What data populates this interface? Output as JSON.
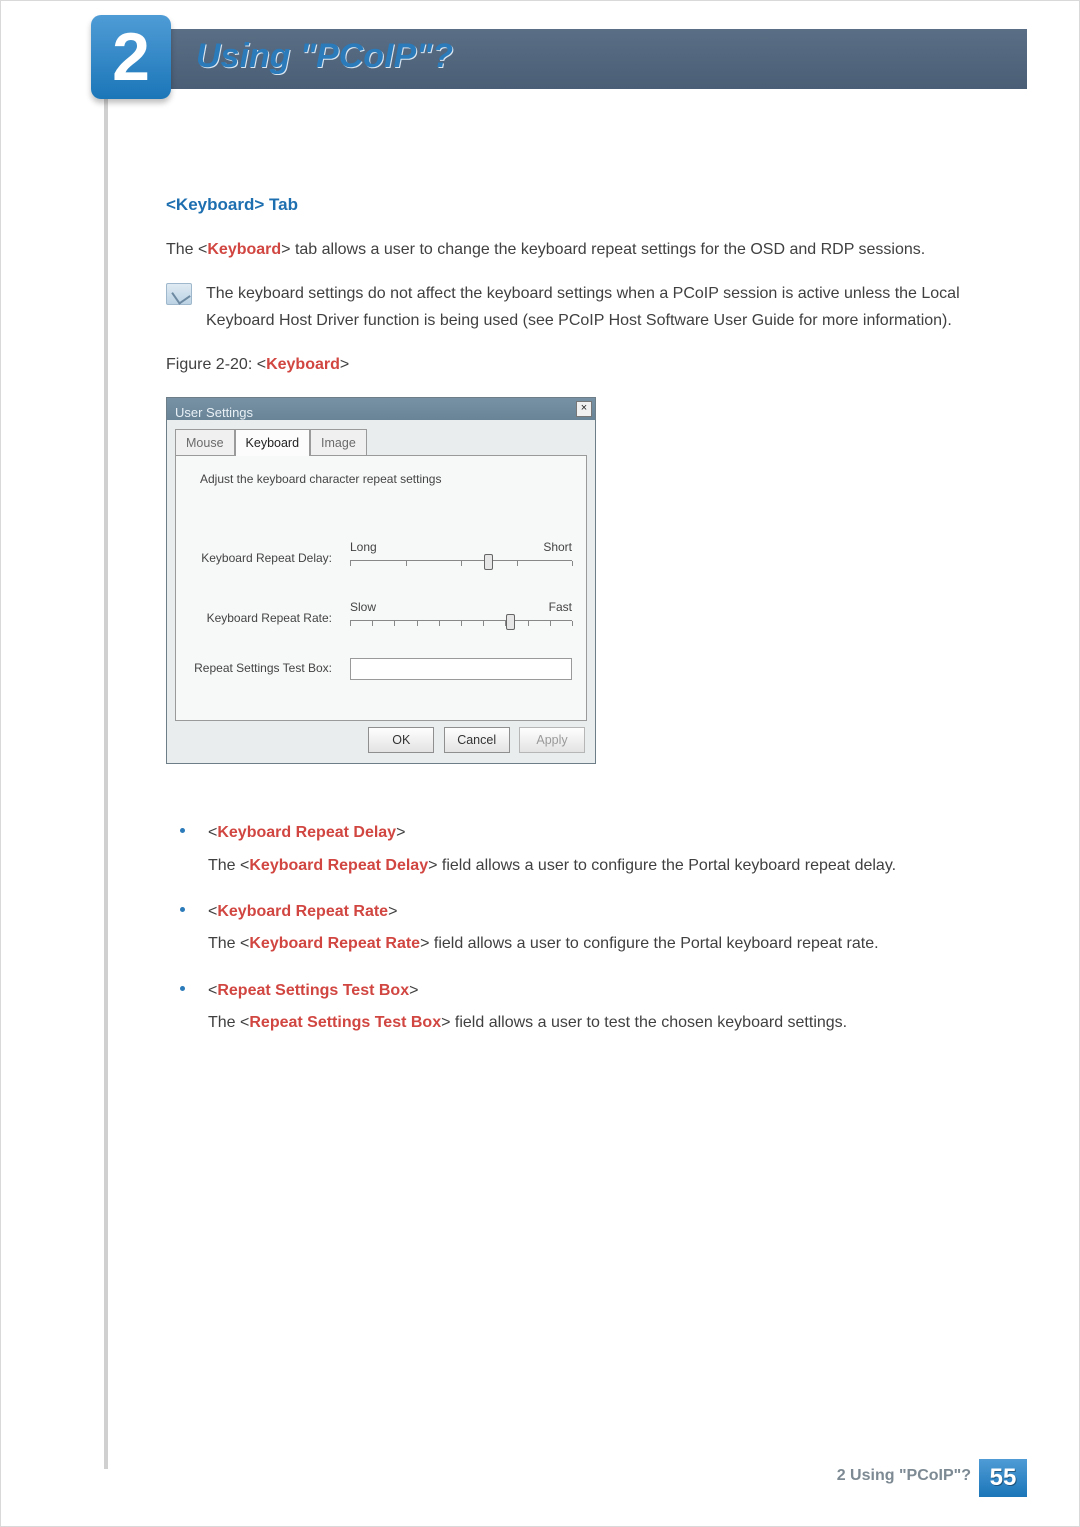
{
  "chapter": {
    "number": "2",
    "title": "Using \"PCoIP\"?"
  },
  "section": {
    "heading": "<Keyboard> Tab"
  },
  "intro": {
    "prefix": "The <",
    "kw": "Keyboard",
    "suffix": "> tab allows a user to change the keyboard repeat settings for the OSD and RDP sessions."
  },
  "note": "The keyboard settings do not affect the keyboard settings when a PCoIP session is active unless the Local Keyboard Host Driver function is being used (see PCoIP Host Software User Guide for more information).",
  "figure": {
    "prefix": "Figure 2-20: <",
    "kw": "Keyboard",
    "suffix": ">"
  },
  "dialog": {
    "title": "User Settings",
    "tabs": [
      "Mouse",
      "Keyboard",
      "Image"
    ],
    "active_tab_index": 1,
    "hint": "Adjust the keyboard character repeat settings",
    "delay": {
      "label": "Keyboard Repeat Delay:",
      "left": "Long",
      "right": "Short",
      "pos_pct": 62,
      "ticks": 5
    },
    "rate": {
      "label": "Keyboard Repeat Rate:",
      "left": "Slow",
      "right": "Fast",
      "pos_pct": 72,
      "ticks": 11
    },
    "testbox_label": "Repeat Settings Test Box:",
    "buttons": {
      "ok": "OK",
      "cancel": "Cancel",
      "apply": "Apply"
    }
  },
  "bullets": [
    {
      "head": "Keyboard Repeat Delay",
      "body_prefix": "The <",
      "body_kw": "Keyboard Repeat Delay",
      "body_suffix": "> field allows a user to configure the Portal keyboard repeat delay."
    },
    {
      "head": "Keyboard Repeat Rate",
      "body_prefix": "The <",
      "body_kw": "Keyboard Repeat Rate",
      "body_suffix": "> field allows a user to configure the Portal keyboard repeat rate."
    },
    {
      "head": "Repeat Settings Test Box",
      "body_prefix": "The <",
      "body_kw": "Repeat Settings Test Box",
      "body_suffix": "> field allows a user to test the chosen keyboard settings."
    }
  ],
  "footer": {
    "text": "2 Using \"PCoIP\"?",
    "page": "55"
  }
}
